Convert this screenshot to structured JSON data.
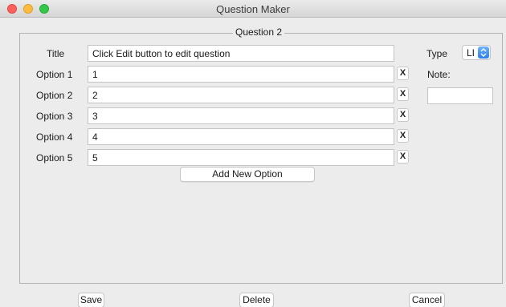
{
  "window": {
    "title": "Question Maker"
  },
  "group": {
    "title": "Question 2"
  },
  "form": {
    "title_label": "Title",
    "title_value": "Click Edit button to edit question",
    "type_label": "Type",
    "type_value": "LI",
    "note_label": "Note:",
    "note_value": "",
    "remove_label": "X",
    "options": [
      {
        "label": "Option 1",
        "value": "1"
      },
      {
        "label": "Option 2",
        "value": "2"
      },
      {
        "label": "Option 3",
        "value": "3"
      },
      {
        "label": "Option 4",
        "value": "4"
      },
      {
        "label": "Option 5",
        "value": "5"
      }
    ],
    "add_option_label": "Add New Option"
  },
  "footer": {
    "save_label": "Save",
    "delete_label": "Delete",
    "cancel_label": "Cancel"
  },
  "colors": {
    "close": "#fc605c",
    "minimize": "#fdbc40",
    "maximize": "#34c84a",
    "select_accent": "#2e7ee7"
  },
  "icons": [
    "close-icon",
    "minimize-icon",
    "maximize-icon",
    "updown-chevron-icon"
  ]
}
